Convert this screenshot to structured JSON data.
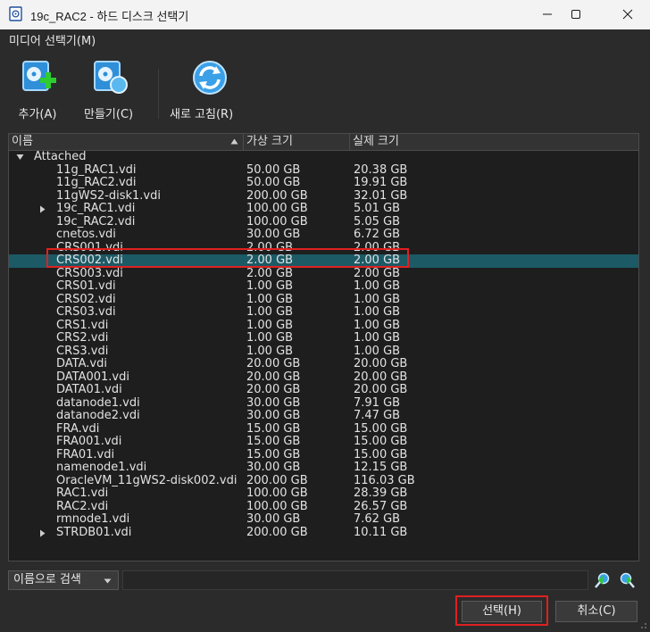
{
  "window": {
    "title": "19c_RAC2 - 하드 디스크 선택기"
  },
  "menu": {
    "media": "미디어 선택기(M)"
  },
  "toolbar": {
    "add": "추가(A)",
    "create": "만들기(C)",
    "refresh": "새로 고침(R)"
  },
  "columns": {
    "name": "이름",
    "virtual": "가상 크기",
    "actual": "실제 크기"
  },
  "group": "Attached",
  "rows": [
    {
      "name": "11g_RAC1.vdi",
      "virtual": "50.00 GB",
      "actual": "20.38 GB"
    },
    {
      "name": "11g_RAC2.vdi",
      "virtual": "50.00 GB",
      "actual": "19.91 GB"
    },
    {
      "name": "11gWS2-disk1.vdi",
      "virtual": "200.00 GB",
      "actual": "32.01 GB"
    },
    {
      "name": "19c_RAC1.vdi",
      "virtual": "100.00 GB",
      "actual": "5.01 GB"
    },
    {
      "name": "19c_RAC2.vdi",
      "virtual": "100.00 GB",
      "actual": "5.05 GB"
    },
    {
      "name": "cnetos.vdi",
      "virtual": "30.00 GB",
      "actual": "6.72 GB"
    },
    {
      "name": "CRS001.vdi",
      "virtual": "2.00 GB",
      "actual": "2.00 GB"
    },
    {
      "name": "CRS002.vdi",
      "virtual": "2.00 GB",
      "actual": "2.00 GB"
    },
    {
      "name": "CRS003.vdi",
      "virtual": "2.00 GB",
      "actual": "2.00 GB"
    },
    {
      "name": "CRS01.vdi",
      "virtual": "1.00 GB",
      "actual": "1.00 GB"
    },
    {
      "name": "CRS02.vdi",
      "virtual": "1.00 GB",
      "actual": "1.00 GB"
    },
    {
      "name": "CRS03.vdi",
      "virtual": "1.00 GB",
      "actual": "1.00 GB"
    },
    {
      "name": "CRS1.vdi",
      "virtual": "1.00 GB",
      "actual": "1.00 GB"
    },
    {
      "name": "CRS2.vdi",
      "virtual": "1.00 GB",
      "actual": "1.00 GB"
    },
    {
      "name": "CRS3.vdi",
      "virtual": "1.00 GB",
      "actual": "1.00 GB"
    },
    {
      "name": "DATA.vdi",
      "virtual": "20.00 GB",
      "actual": "20.00 GB"
    },
    {
      "name": "DATA001.vdi",
      "virtual": "20.00 GB",
      "actual": "20.00 GB"
    },
    {
      "name": "DATA01.vdi",
      "virtual": "20.00 GB",
      "actual": "20.00 GB"
    },
    {
      "name": "datanode1.vdi",
      "virtual": "30.00 GB",
      "actual": "7.91 GB"
    },
    {
      "name": "datanode2.vdi",
      "virtual": "30.00 GB",
      "actual": "7.47 GB"
    },
    {
      "name": "FRA.vdi",
      "virtual": "15.00 GB",
      "actual": "15.00 GB"
    },
    {
      "name": "FRA001.vdi",
      "virtual": "15.00 GB",
      "actual": "15.00 GB"
    },
    {
      "name": "FRA01.vdi",
      "virtual": "15.00 GB",
      "actual": "15.00 GB"
    },
    {
      "name": "namenode1.vdi",
      "virtual": "30.00 GB",
      "actual": "12.15 GB"
    },
    {
      "name": "OracleVM_11gWS2-disk002.vdi",
      "virtual": "200.00 GB",
      "actual": "116.03 GB"
    },
    {
      "name": "RAC1.vdi",
      "virtual": "100.00 GB",
      "actual": "28.39 GB"
    },
    {
      "name": "RAC2.vdi",
      "virtual": "100.00 GB",
      "actual": "26.57 GB"
    },
    {
      "name": "rmnode1.vdi",
      "virtual": "30.00 GB",
      "actual": "7.62 GB"
    },
    {
      "name": "STRDB01.vdi",
      "virtual": "200.00 GB",
      "actual": "10.11 GB"
    }
  ],
  "search": {
    "mode": "이름으로 검색"
  },
  "buttons": {
    "select": "선택(H)",
    "cancel": "취소(C)"
  },
  "colors": {
    "selection": "#1c5a66",
    "highlight_box": "#e02020"
  }
}
